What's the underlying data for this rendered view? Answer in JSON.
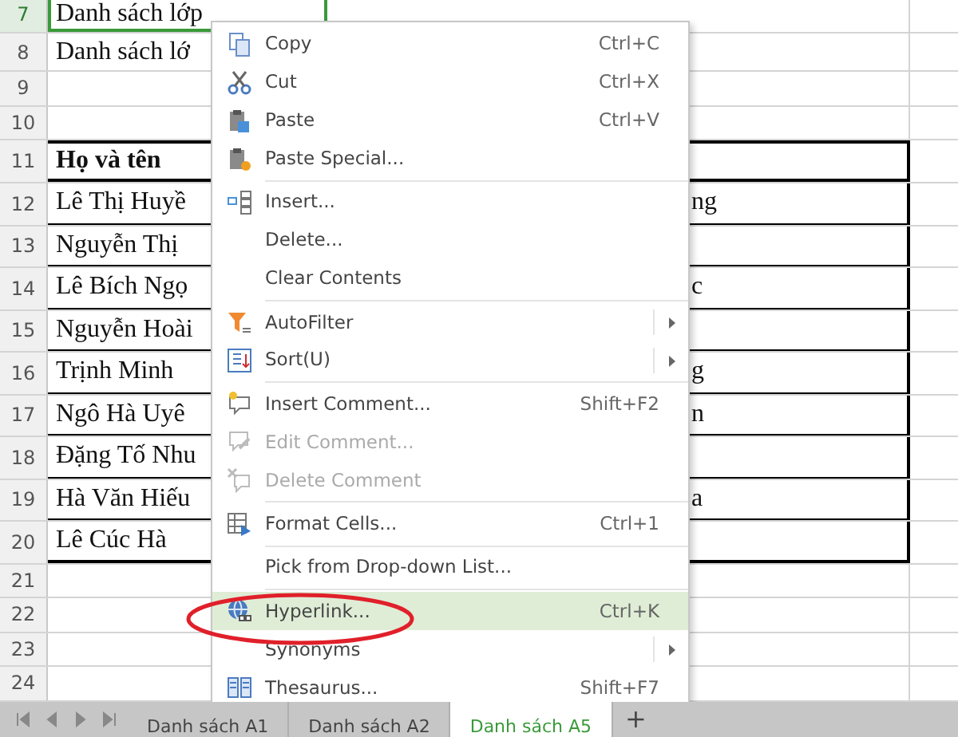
{
  "sheet_rows": [
    {
      "number": "7",
      "kind": "title",
      "selected": true,
      "cells": [
        "Danh sách lớp",
        ""
      ]
    },
    {
      "number": "8",
      "kind": "title",
      "selected": false,
      "cells": [
        "Danh sách lớ",
        ""
      ]
    },
    {
      "number": "9",
      "kind": "blank",
      "selected": false,
      "cells": [
        "",
        ""
      ]
    },
    {
      "number": "10",
      "kind": "blank",
      "selected": false,
      "cells": [
        "",
        ""
      ]
    },
    {
      "number": "11",
      "kind": "header",
      "selected": false,
      "cells": [
        "Họ và tên",
        ""
      ]
    },
    {
      "number": "12",
      "kind": "data",
      "selected": false,
      "cells": [
        "Lê Thị Huyề",
        "ng"
      ]
    },
    {
      "number": "13",
      "kind": "data",
      "selected": false,
      "cells": [
        "Nguyễn Thị",
        ""
      ]
    },
    {
      "number": "14",
      "kind": "data",
      "selected": false,
      "cells": [
        "Lê Bích Ngọ",
        "c"
      ]
    },
    {
      "number": "15",
      "kind": "data",
      "selected": false,
      "cells": [
        "Nguyễn Hoài",
        ""
      ]
    },
    {
      "number": "16",
      "kind": "data",
      "selected": false,
      "cells": [
        "Trịnh Minh",
        "g"
      ]
    },
    {
      "number": "17",
      "kind": "data",
      "selected": false,
      "cells": [
        "Ngô Hà Uyê",
        "n"
      ]
    },
    {
      "number": "18",
      "kind": "data",
      "selected": false,
      "cells": [
        "Đặng Tố Nhu",
        ""
      ]
    },
    {
      "number": "19",
      "kind": "data",
      "selected": false,
      "cells": [
        "Hà Văn Hiếu",
        "a"
      ]
    },
    {
      "number": "20",
      "kind": "last",
      "selected": false,
      "cells": [
        "Lê Cúc Hà",
        ""
      ]
    },
    {
      "number": "21",
      "kind": "blank",
      "selected": false,
      "cells": [
        "",
        ""
      ]
    },
    {
      "number": "22",
      "kind": "blank",
      "selected": false,
      "cells": [
        "",
        ""
      ]
    },
    {
      "number": "23",
      "kind": "blank",
      "selected": false,
      "cells": [
        "",
        ""
      ]
    },
    {
      "number": "24",
      "kind": "blank",
      "selected": false,
      "cells": [
        "",
        ""
      ]
    }
  ],
  "context_menu": [
    {
      "kind": "item",
      "label": "Copy",
      "shortcut": "Ctrl+C",
      "disabled": false,
      "selected": false,
      "has_submenu": false
    },
    {
      "kind": "item",
      "label": "Cut",
      "shortcut": "Ctrl+X",
      "disabled": false,
      "selected": false,
      "has_submenu": false
    },
    {
      "kind": "item",
      "label": "Paste",
      "shortcut": "Ctrl+V",
      "disabled": false,
      "selected": false,
      "has_submenu": false
    },
    {
      "kind": "item",
      "label": "Paste Special...",
      "disabled": false,
      "selected": false,
      "has_submenu": false
    },
    {
      "kind": "separator"
    },
    {
      "kind": "item",
      "label": "Insert...",
      "disabled": false,
      "selected": false,
      "has_submenu": false
    },
    {
      "kind": "item",
      "label": "Delete...",
      "disabled": false,
      "selected": false,
      "has_submenu": false
    },
    {
      "kind": "item",
      "label": "Clear Contents",
      "disabled": false,
      "selected": false,
      "has_submenu": false
    },
    {
      "kind": "separator"
    },
    {
      "kind": "item",
      "label": "AutoFilter",
      "disabled": false,
      "selected": false,
      "has_submenu": true
    },
    {
      "kind": "item",
      "label": "Sort(U)",
      "disabled": false,
      "selected": false,
      "has_submenu": true
    },
    {
      "kind": "separator"
    },
    {
      "kind": "item",
      "label": "Insert Comment...",
      "shortcut": "Shift+F2",
      "disabled": false,
      "selected": false,
      "has_submenu": false
    },
    {
      "kind": "item",
      "label": "Edit Comment...",
      "disabled": true,
      "selected": false,
      "has_submenu": false
    },
    {
      "kind": "item",
      "label": "Delete Comment",
      "disabled": true,
      "selected": false,
      "has_submenu": false
    },
    {
      "kind": "separator"
    },
    {
      "kind": "item",
      "label": "Format Cells...",
      "shortcut": "Ctrl+1",
      "disabled": false,
      "selected": false,
      "has_submenu": false
    },
    {
      "kind": "separator"
    },
    {
      "kind": "item",
      "label": "Pick from Drop-down List...",
      "disabled": false,
      "selected": false,
      "has_submenu": false
    },
    {
      "kind": "separator"
    },
    {
      "kind": "item",
      "label": "Hyperlink...",
      "shortcut": "Ctrl+K",
      "disabled": false,
      "selected": true,
      "has_submenu": false
    },
    {
      "kind": "item",
      "label": "Synonyms",
      "disabled": false,
      "selected": false,
      "has_submenu": true
    },
    {
      "kind": "item",
      "label": "Thesaurus...",
      "shortcut": "Shift+F7",
      "disabled": false,
      "selected": false,
      "has_submenu": false
    }
  ],
  "sheet_tabs": [
    {
      "label": "Danh sách A1",
      "selected": false
    },
    {
      "label": "Danh sách A2",
      "selected": false
    },
    {
      "label": "Danh sách A5",
      "selected": true
    }
  ],
  "add_sheet": "+"
}
